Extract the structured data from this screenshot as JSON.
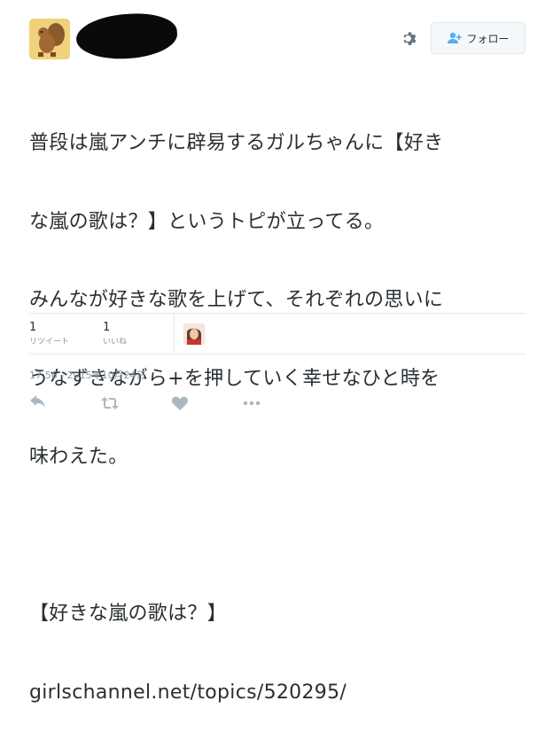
{
  "header": {
    "follow_label": "フォロー",
    "icons": {
      "settings": "gear-icon",
      "follow": "add-user-icon"
    }
  },
  "tweet": {
    "lines": [
      "普段は嵐アンチに辟易するガルちゃんに【好き",
      "な嵐の歌は？】というトピが立ってる。",
      "みんなが好きな歌を上げて、それぞれの思いに",
      "うなずきながら+を押していく幸せなひと時を",
      "味わえた。"
    ],
    "quote_title": "【好きな嵐の歌は？】",
    "link": "girlschannel.net/topics/520295/"
  },
  "stats": {
    "retweets": {
      "count": "1",
      "label": "リツイート"
    },
    "likes": {
      "count": "1",
      "label": "いいね"
    }
  },
  "timestamp": "17:56 - 2015年10月24日",
  "actions": [
    "reply-icon",
    "retweet-icon",
    "like-icon",
    "more-icon"
  ],
  "colors": {
    "text": "#292f33",
    "muted": "#8899a6",
    "action_icon": "#aab8c2",
    "accent": "#55acee",
    "divider": "#e1e8ed"
  }
}
